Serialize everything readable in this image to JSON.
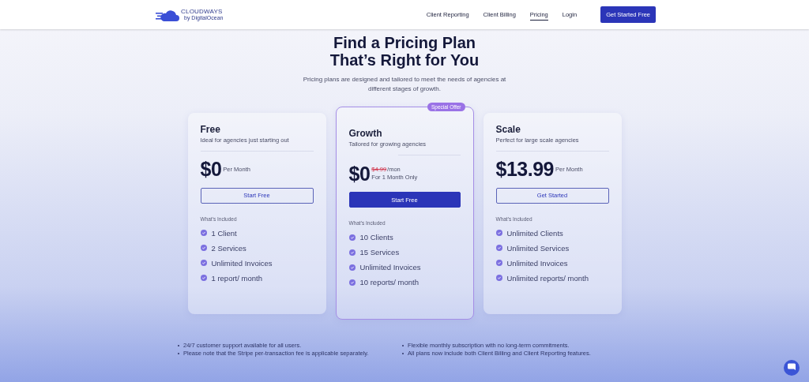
{
  "nav": {
    "logo": {
      "name": "CLOUDWAYS",
      "byline": "by DigitalOcean"
    },
    "links": [
      {
        "label": "Client Reporting",
        "selected": false
      },
      {
        "label": "Client Billing",
        "selected": false
      },
      {
        "label": "Pricing",
        "selected": true
      },
      {
        "label": "Login",
        "selected": false
      }
    ],
    "cta": "Get Started Free"
  },
  "hero": {
    "title_lines": [
      "Find a Pricing Plan",
      "That’s Right for You"
    ],
    "subtitle": "Pricing plans are designed and tailored to meet the needs of agencies at different stages of growth."
  },
  "plans": [
    {
      "name": "Free",
      "description": "Ideal for agencies just starting out",
      "featured": false,
      "price": "$0",
      "price_note": "Per Month",
      "button": "Start Free",
      "included_label": "What's Included",
      "features": [
        "1 Client",
        "2 Services",
        "Unlimited Invoices",
        "1 report/ month"
      ]
    },
    {
      "name": "Growth",
      "description": "Tailored for growing agencies",
      "featured": true,
      "badge": "Special Offer",
      "price": "$0",
      "old_price": "$4.99",
      "price_note": "/mon",
      "price_note_2": "For 1 Month Only",
      "button": "Start Free",
      "included_label": "What's Included",
      "features": [
        "10 Clients",
        "15 Services",
        "Unlimited Invoices",
        "10 reports/ month"
      ]
    },
    {
      "name": "Scale",
      "description": "Perfect for large scale agencies",
      "featured": false,
      "price": "$13.99",
      "price_note": "Per Month",
      "button": "Get Started",
      "included_label": "What's Included",
      "features": [
        "Unlimited Clients",
        "Unlimited Services",
        "Unlimited Invoices",
        "Unlimited reports/ month"
      ]
    }
  ],
  "notes": [
    [
      "24/7 customer support available for all users.",
      "Please note that the Stripe per-transaction fee is applicable separately."
    ],
    [
      "Flexible monthly subscription with no long-term commitments.",
      "All plans now include both Client Billing and Client Reporting features."
    ]
  ]
}
